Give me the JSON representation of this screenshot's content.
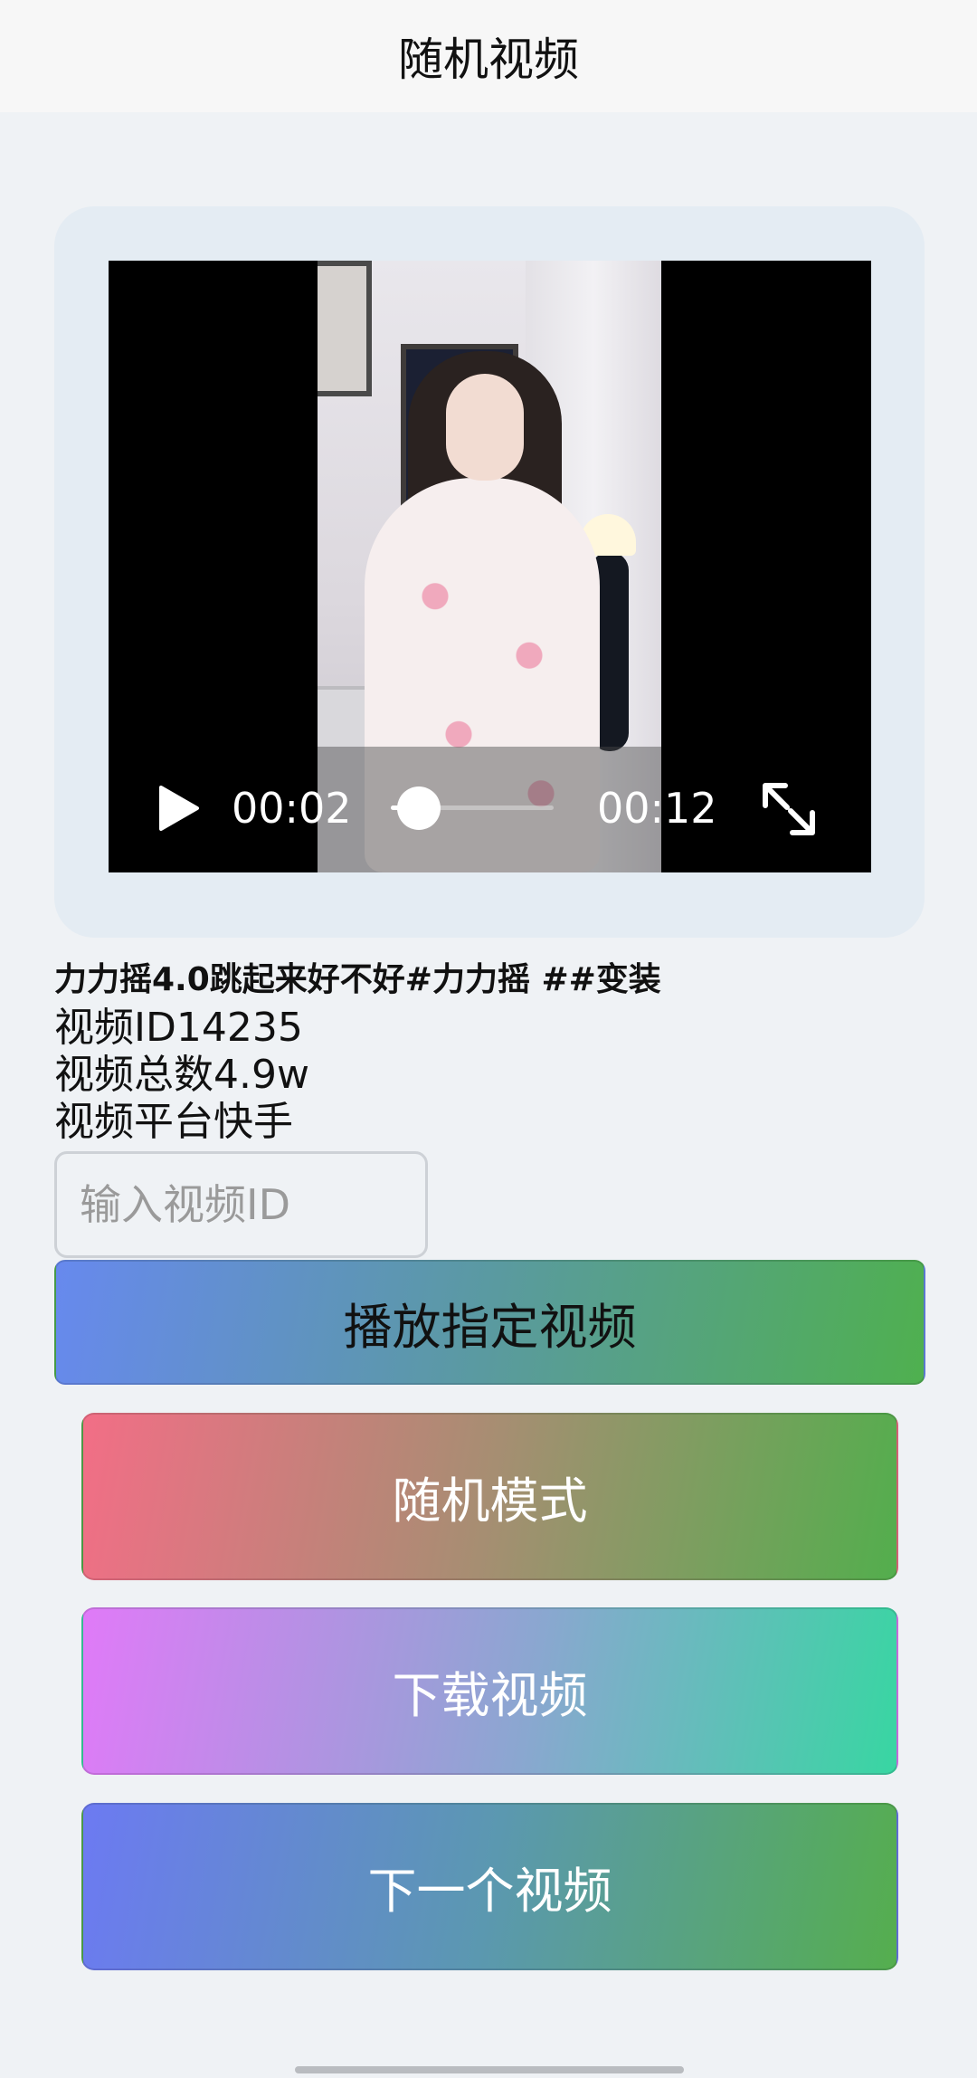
{
  "header": {
    "title": "随机视频"
  },
  "player": {
    "current_time": "00:02",
    "duration": "00:12",
    "progress_fraction": 0.17,
    "icons": {
      "play": "play-icon",
      "fullscreen": "fullscreen-icon"
    }
  },
  "video_info": {
    "title": "力力摇4.0跳起来好不好#力力摇 ##变装",
    "id_line": "视频ID14235",
    "total_line": "视频总数4.9w",
    "platform_line": "视频平台快手"
  },
  "search": {
    "placeholder": "输入视频ID"
  },
  "buttons": {
    "play_specified": "播放指定视频",
    "random_mode": "随机模式",
    "download": "下载视频",
    "next": "下一个视频"
  }
}
